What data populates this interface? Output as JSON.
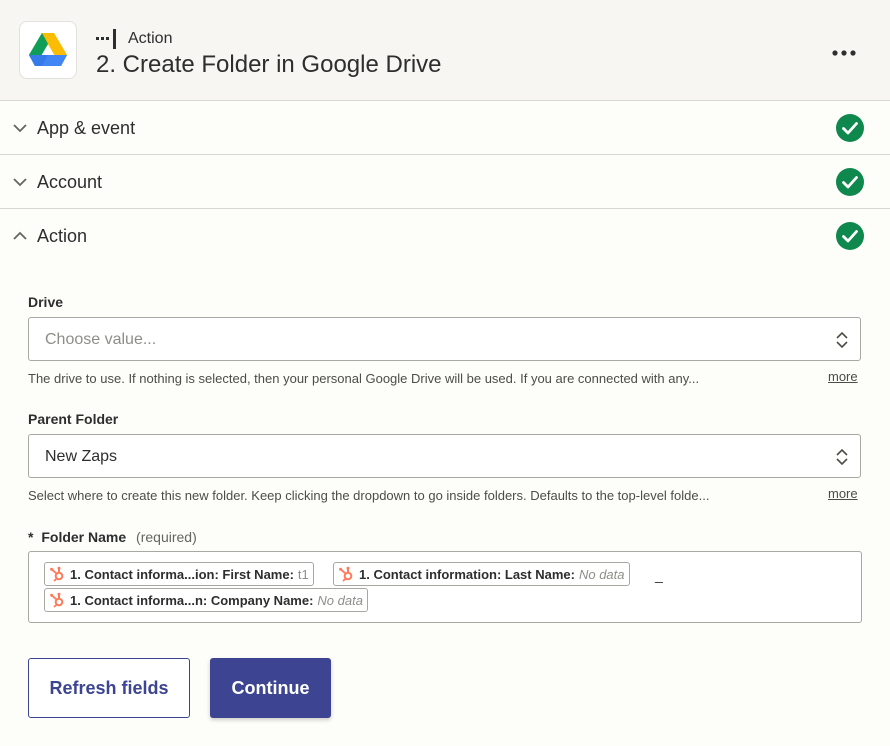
{
  "header": {
    "step_kind": "Action",
    "title": "2. Create Folder in Google Drive",
    "app_icon": "google-drive-icon",
    "menu_icon": "more-dots-icon"
  },
  "sections": [
    {
      "label": "App & event",
      "state": "collapsed",
      "complete": true
    },
    {
      "label": "Account",
      "state": "collapsed",
      "complete": true
    },
    {
      "label": "Action",
      "state": "expanded",
      "complete": true
    }
  ],
  "fields": {
    "drive": {
      "label": "Drive",
      "placeholder": "Choose value...",
      "help": "The drive to use. If nothing is selected, then your personal Google Drive will be used. If you are connected with any...",
      "more": "more"
    },
    "parent_folder": {
      "label": "Parent Folder",
      "value": "New Zaps",
      "help": "Select where to create this new folder. Keep clicking the dropdown to go inside folders. Defaults to the top-level folde...",
      "more": "more"
    },
    "folder_name": {
      "required_mark": "*",
      "label": "Folder Name",
      "required_text": "(required)",
      "pills": [
        {
          "label": "1. Contact informa...ion: First Name:",
          "value": "t1",
          "empty": false
        },
        {
          "label": "1. Contact information: Last Name:",
          "value": "No data",
          "empty": true
        },
        {
          "label": "1. Contact informa...n: Company Name:",
          "value": "No data",
          "empty": true
        }
      ],
      "separator": "_"
    }
  },
  "buttons": {
    "refresh": "Refresh fields",
    "continue": "Continue"
  },
  "colors": {
    "accent": "#3d4592",
    "success": "#0f884e",
    "hubspot": "#ff7a59"
  }
}
